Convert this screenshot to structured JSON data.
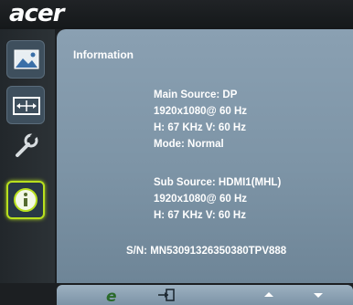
{
  "brand": {
    "logo_text": "acer"
  },
  "sidebar": {
    "items": [
      {
        "icon": "picture-icon",
        "active": false
      },
      {
        "icon": "display-position-icon",
        "active": false
      },
      {
        "icon": "wrench-icon",
        "active": false
      },
      {
        "icon": "info-icon",
        "active": true
      }
    ]
  },
  "panel": {
    "title": "Information",
    "main_source": {
      "label": "Main Source: DP",
      "resolution": "1920x1080@ 60 Hz",
      "frequency": "H: 67 KHz   V: 60 Hz",
      "mode": "Mode: Normal"
    },
    "sub_source": {
      "label": "Sub Source: HDMI1(MHL)",
      "resolution": "1920x1080@ 60 Hz",
      "frequency": "H: 67 KHz   V: 60 Hz"
    },
    "serial": "S/N: MN53091326350380TPV888"
  },
  "bottom_bar": {
    "buttons": [
      "empowering-e-icon",
      "exit-icon",
      "up-arrow-icon",
      "down-arrow-icon"
    ]
  },
  "colors": {
    "accent": "#b8e01e",
    "panel": "#8aa0b2"
  }
}
